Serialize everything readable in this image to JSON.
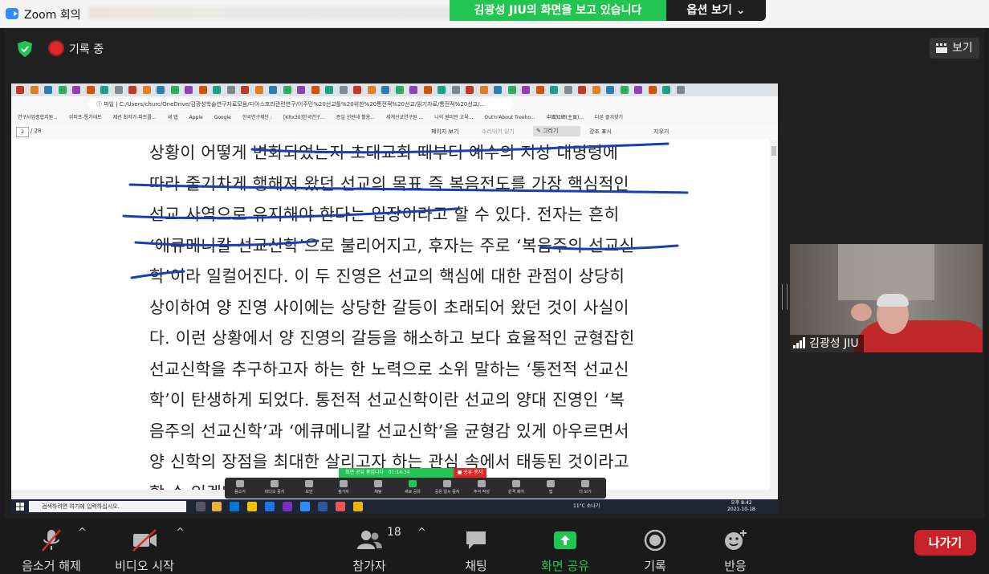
{
  "window": {
    "title": "Zoom 회의"
  },
  "share_banner": {
    "text": "김광성 JIU의 화면을 보고 있습니다",
    "options_label": "옵션 보기 ⌄"
  },
  "meeting": {
    "recording_label": "기록 중",
    "view_label": "보기"
  },
  "browser": {
    "address": "ⓘ 파일 | C:/Users/churc/OneDrive/김광성학술연구자료모음/디아스포라관련연구/이주민%20선교틀%20위한%20통전적%20선교/읽기자료/통전적%20선교/...",
    "bookmarks": [
      "연구사업종합지원...",
      "위피프-통가데트",
      "제션 최저가-파트를...",
      "새 탭",
      "Apple",
      "Google",
      "한국연구재단 :",
      "[KRx30]한국연구...",
      "종일 선반데 활용...",
      "세계선교연구원 ...",
      "나의 원미민 교육...",
      "Out'n'About Treeho...",
      "中國知網(主頁)...",
      "다른 즐겨찾기"
    ]
  },
  "pdf_toolbar": {
    "page_number": "2",
    "page_of": "/ 28",
    "page_view": "페이지 보기",
    "read_aloud": "소리내어 읽기",
    "draw": "그리기",
    "highlight": "강조 표시",
    "erase": "지우기"
  },
  "document": {
    "lines": [
      "상황이 어떻게 변화되었는지 초대교회 때부터 예수의 지상 대명령에",
      "따라 줄기차게 행해져 왔던 선교의 목표 즉 복음전도를 가장 핵심적인",
      "선교 사역으로 유지해야 한다는 입장이라고 할 수 있다. 전자는 흔히",
      "‘에큐메니칼 선교신학’으로 불리어지고, 후자는 주로 ‘복음주의 선교신",
      "학’이라 일컬어진다. 이 두 진영은 선교의 핵심에 대한 관점이 상당히",
      "상이하여 양 진영 사이에는 상당한 갈등이 초래되어 왔던 것이 사실이",
      "다. 이런 상황에서 양 진영의 갈등을 해소하고 보다 효율적인 균형잡힌",
      "선교신학을 추구하고자 하는 한 노력으로 소위 말하는 ‘통전적 선교신",
      "학’이 탄생하게 되었다. 통전적 선교신학이란 선교의 양대 진영인 ‘복",
      "음주의 선교신학’과 ‘에큐메니칼 선교신학’을 균형감 있게 아우르면서",
      "양 신학의 장점을 최대한 살리고자 하는 관심 속에서 태동된 것이라고",
      "할 수 있겠다."
    ]
  },
  "mini_share": {
    "status": "화면 공유 중입니다",
    "timer": "01:14:34",
    "stop": "■ 공유 중지",
    "items": [
      "음소거",
      "비디오 중지",
      "보안",
      "참가자",
      "채팅",
      "새로 공유",
      "공유 일시 중지",
      "주석 작성",
      "원격 제어",
      "앱",
      "더 보기"
    ]
  },
  "taskbar": {
    "search_placeholder": "검색하려면 여기에 입력하십시오.",
    "weather": "11°C 소나기",
    "time": "오후 8:42",
    "date": "2021-10-18"
  },
  "thumbnail": {
    "name": "김광성 JIU"
  },
  "toolbar": {
    "mute": "음소거 해제",
    "video": "비디오 시작",
    "participants": "참가자",
    "participant_count": "18",
    "chat": "채팅",
    "share": "화면 공유",
    "record": "기록",
    "reactions": "반응",
    "leave": "나가기"
  },
  "colors": {
    "share_green": "#23c552",
    "leave_red": "#c8222a",
    "pen_blue": "#1a3fb5",
    "zoom_blue": "#2d8cff"
  }
}
